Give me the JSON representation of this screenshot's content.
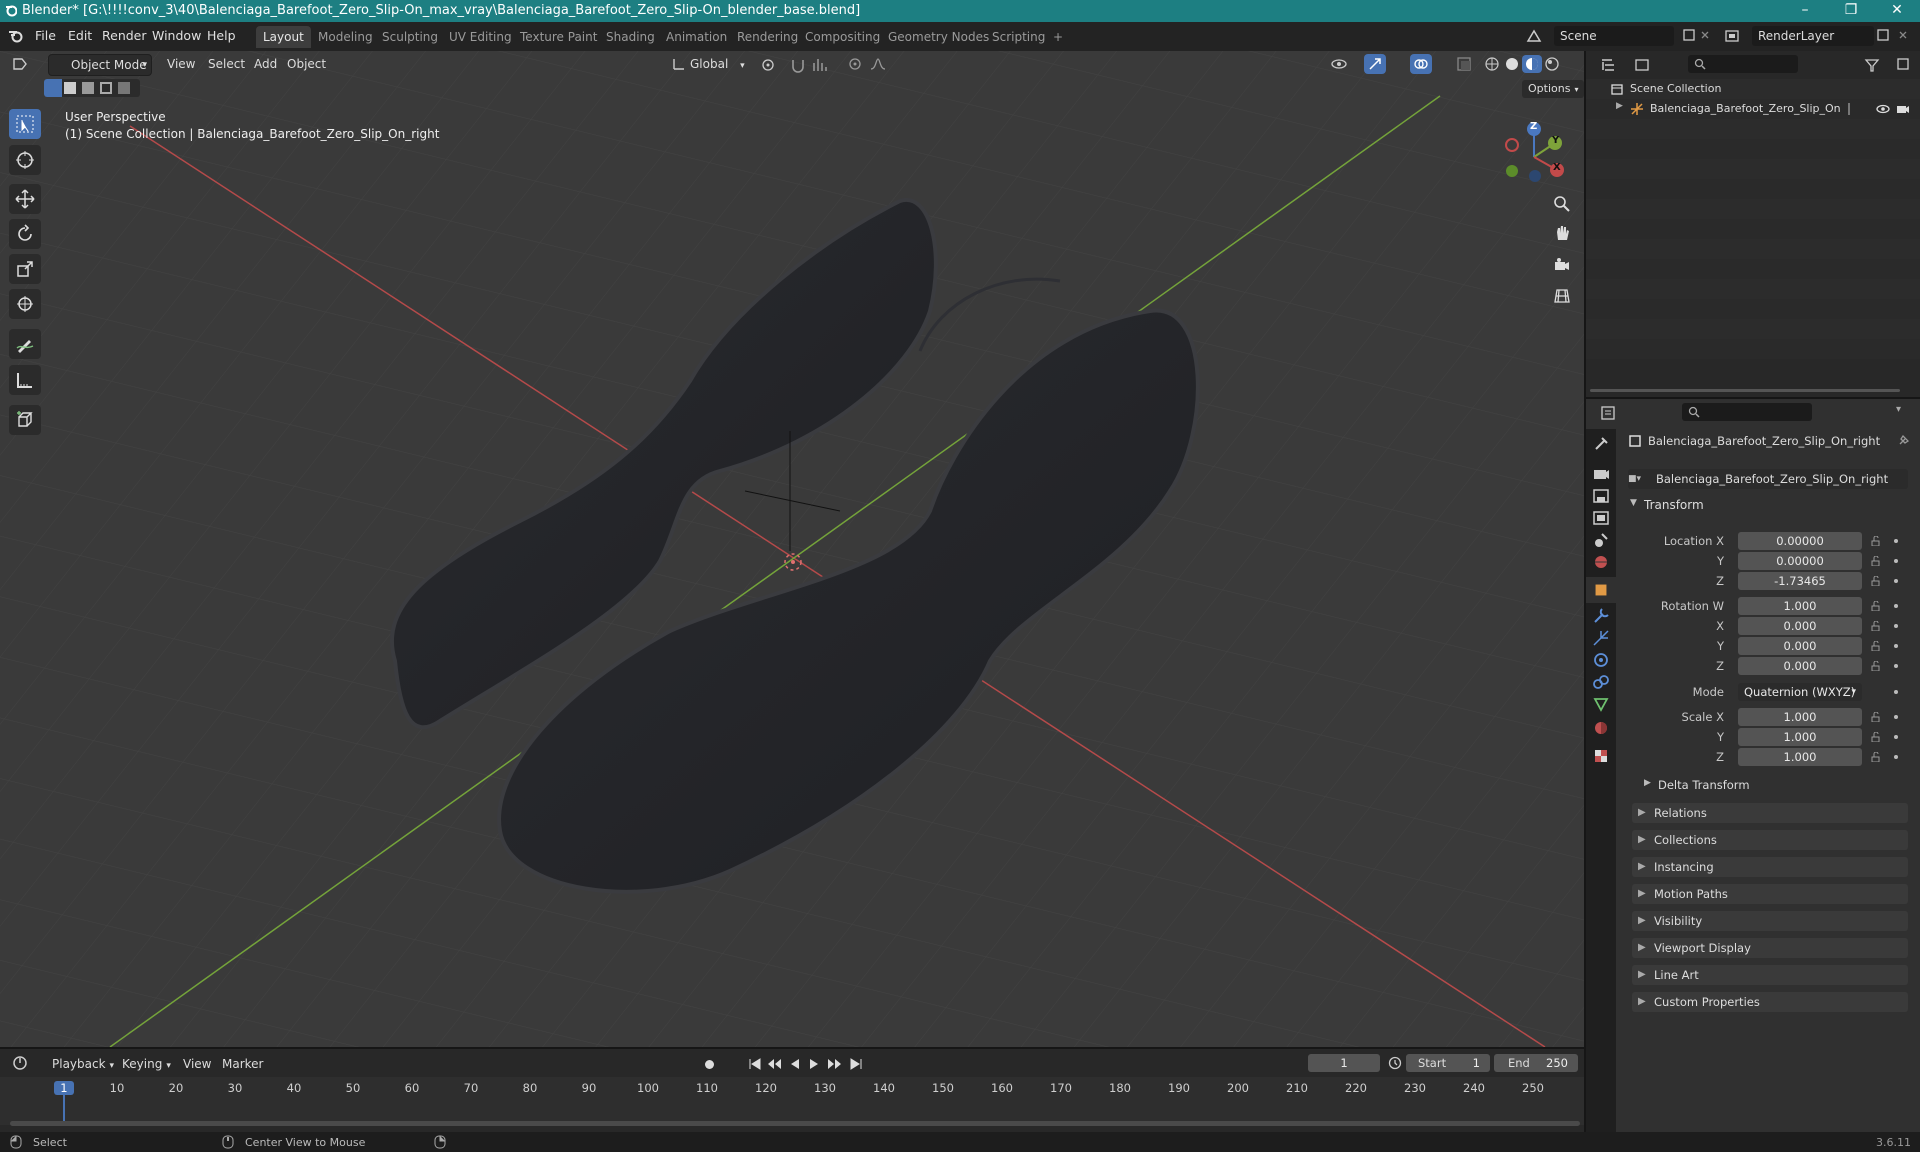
{
  "window": {
    "title": "Blender* [G:\\!!!!conv_3\\40\\Balenciaga_Barefoot_Zero_Slip-On_max_vray\\Balenciaga_Barefoot_Zero_Slip-On_blender_base.blend]",
    "controls": [
      "–",
      "❐",
      "✕"
    ]
  },
  "menu": [
    "File",
    "Edit",
    "Render",
    "Window",
    "Help"
  ],
  "workspaces": [
    "Layout",
    "Modeling",
    "Sculpting",
    "UV Editing",
    "Texture Paint",
    "Shading",
    "Animation",
    "Rendering",
    "Compositing",
    "Geometry Nodes",
    "Scripting",
    "+"
  ],
  "scene_field": "Scene",
  "render_layer_field": "RenderLayer",
  "viewport_header": {
    "mode": "Object Mode",
    "menus": [
      "View",
      "Select",
      "Add",
      "Object"
    ],
    "orientation": "Global",
    "options": "Options"
  },
  "viewport_overlay": {
    "line1": "User Perspective",
    "line2": "(1) Scene Collection | Balenciaga_Barefoot_Zero_Slip_On_right"
  },
  "gizmo": {
    "z": "Z",
    "y": "Y",
    "x": "X"
  },
  "outliner": {
    "collection": "Scene Collection",
    "object": "Balenciaga_Barefoot_Zero_Slip_On"
  },
  "properties": {
    "object_name": "Balenciaga_Barefoot_Zero_Slip_On_right",
    "data_name": "Balenciaga_Barefoot_Zero_Slip_On_right",
    "transform_title": "Transform",
    "location": {
      "label_x": "Location X",
      "label_y": "Y",
      "label_z": "Z",
      "x": "0.00000",
      "y": "0.00000",
      "z": "-1.73465"
    },
    "rotation": {
      "label_w": "Rotation W",
      "label_x": "X",
      "label_y": "Y",
      "label_z": "Z",
      "w": "1.000",
      "x": "0.000",
      "y": "0.000",
      "z": "0.000"
    },
    "mode_label": "Mode",
    "mode_value": "Quaternion (WXYZ)",
    "scale": {
      "label_x": "Scale X",
      "label_y": "Y",
      "label_z": "Z",
      "x": "1.000",
      "y": "1.000",
      "z": "1.000"
    },
    "delta_transform": "Delta Transform",
    "panels": [
      "Relations",
      "Collections",
      "Instancing",
      "Motion Paths",
      "Visibility",
      "Viewport Display",
      "Line Art",
      "Custom Properties"
    ]
  },
  "timeline": {
    "menus": [
      "Playback",
      "Keying",
      "View",
      "Marker"
    ],
    "current_frame": "1",
    "start_label": "Start",
    "start": "1",
    "end_label": "End",
    "end": "250",
    "ruler": [
      "1",
      "10",
      "20",
      "30",
      "40",
      "50",
      "60",
      "70",
      "80",
      "90",
      "100",
      "110",
      "120",
      "130",
      "140",
      "150",
      "160",
      "170",
      "180",
      "190",
      "200",
      "210",
      "220",
      "230",
      "240",
      "250"
    ]
  },
  "status": {
    "select": "Select",
    "center_view": "Center View to Mouse",
    "version": "3.6.11"
  },
  "colors": {
    "titlebar": "#1d7f82",
    "accent": "#4772b3",
    "axis_x": "#c24a4a",
    "axis_y": "#7ea33a",
    "playhead": "#4772b3"
  }
}
